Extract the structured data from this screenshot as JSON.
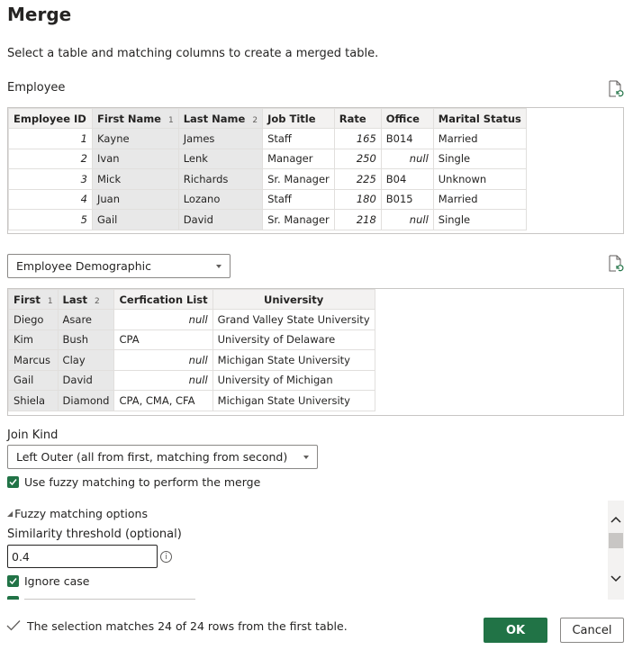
{
  "title": "Merge",
  "description": "Select a table and matching columns to create a merged table.",
  "first_table": {
    "label": "Employee",
    "columns": [
      {
        "label": "Employee ID",
        "sort": ""
      },
      {
        "label": "First Name",
        "sort": "1"
      },
      {
        "label": "Last Name",
        "sort": "2"
      },
      {
        "label": "Job Title",
        "sort": ""
      },
      {
        "label": "Rate",
        "sort": ""
      },
      {
        "label": "Office",
        "sort": ""
      },
      {
        "label": "Marital Status",
        "sort": ""
      }
    ],
    "rows": [
      [
        "1",
        "Kayne",
        "James",
        "Staff",
        "165",
        "B014",
        "Married"
      ],
      [
        "2",
        "Ivan",
        "Lenk",
        "Manager",
        "250",
        "null",
        "Single"
      ],
      [
        "3",
        "Mick",
        "Richards",
        "Sr. Manager",
        "225",
        "B04",
        "Unknown"
      ],
      [
        "4",
        "Juan",
        "Lozano",
        "Staff",
        "180",
        "B015",
        "Married"
      ],
      [
        "5",
        "Gail",
        "David",
        "Sr. Manager",
        "218",
        "null",
        "Single"
      ]
    ]
  },
  "second_table": {
    "selected": "Employee Demographic",
    "columns": [
      {
        "label": "First",
        "sort": "1"
      },
      {
        "label": "Last",
        "sort": "2"
      },
      {
        "label": "Cerfication List",
        "sort": ""
      },
      {
        "label": "University",
        "sort": ""
      }
    ],
    "rows": [
      [
        "Diego",
        "Asare",
        "null",
        "Grand Valley State University"
      ],
      [
        "Kim",
        "Bush",
        "CPA",
        "University of Delaware"
      ],
      [
        "Marcus",
        "Clay",
        "null",
        "Michigan State University"
      ],
      [
        "Gail",
        "David",
        "null",
        "University of Michigan"
      ],
      [
        "Shiela",
        "Diamond",
        "CPA, CMA, CFA",
        "Michigan State University"
      ]
    ]
  },
  "join": {
    "label": "Join Kind",
    "selected": "Left Outer (all from first, matching from second)"
  },
  "fuzzy": {
    "use_label": "Use fuzzy matching to perform the merge",
    "options_label": "Fuzzy matching options",
    "threshold_label": "Similarity threshold (optional)",
    "threshold_value": "0.4",
    "ignore_case_label": "Ignore case"
  },
  "status": "The selection matches 24 of 24 rows from the first table.",
  "buttons": {
    "ok": "OK",
    "cancel": "Cancel"
  },
  "colors": {
    "accent": "#217346"
  }
}
